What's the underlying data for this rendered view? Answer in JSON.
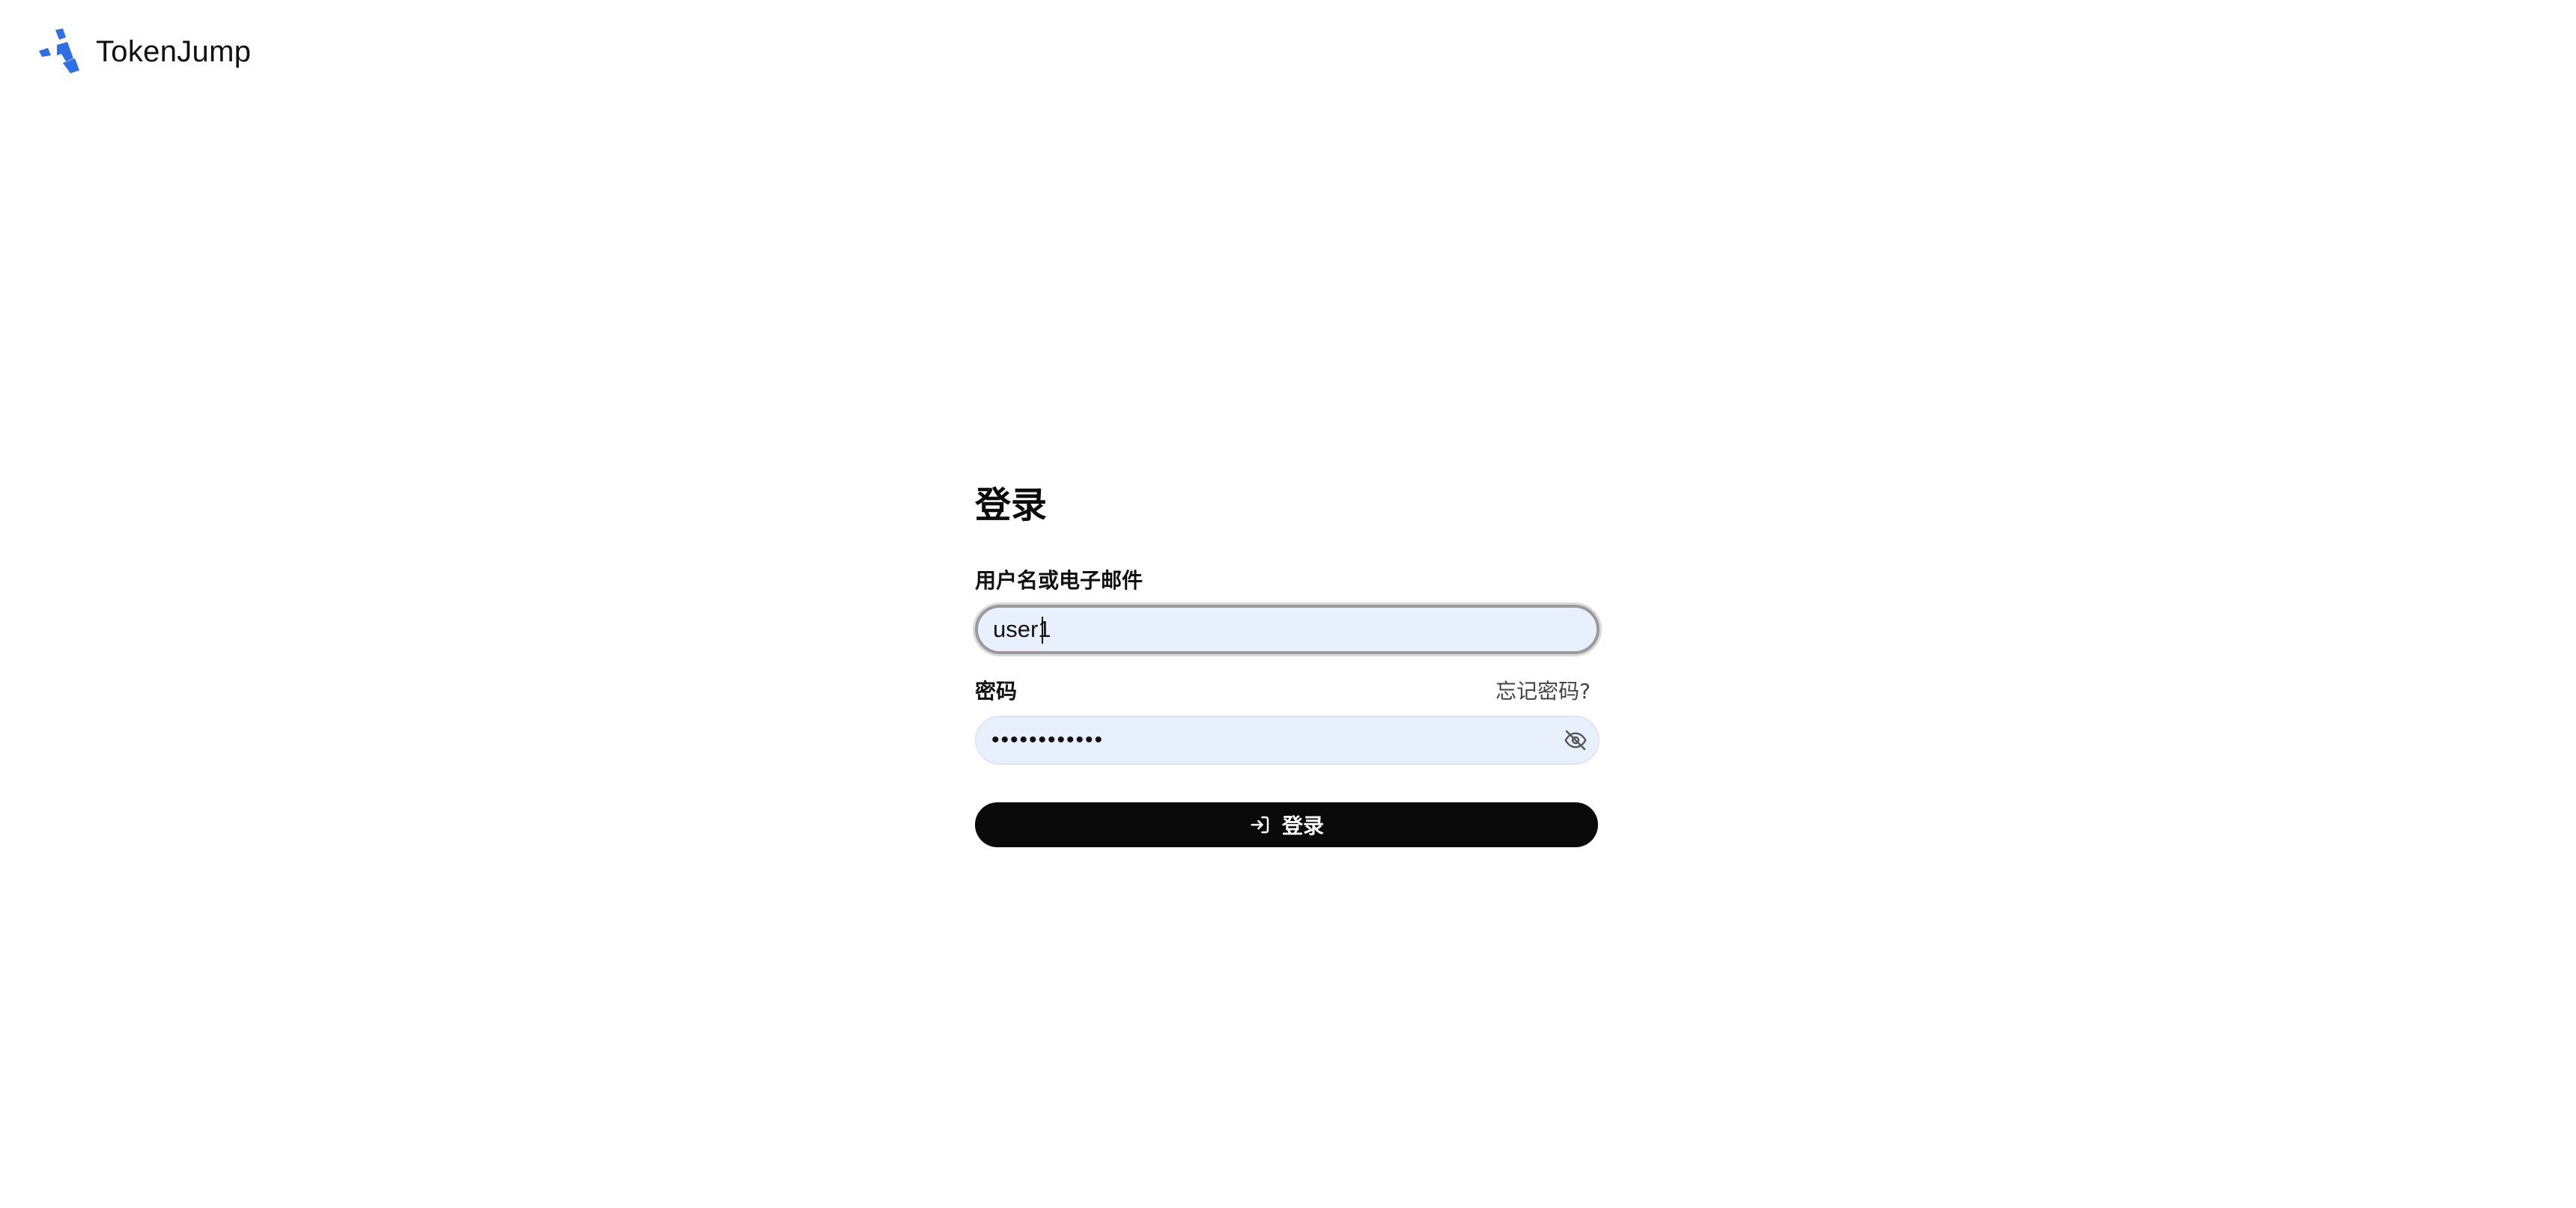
{
  "brand": {
    "name": "TokenJump",
    "logo_icon": "tokenjump-logo-icon",
    "logo_color": "#2f6fe4"
  },
  "login": {
    "title": "登录",
    "username": {
      "label": "用户名或电子邮件",
      "value": "user1"
    },
    "password": {
      "label": "密码",
      "forgot_label": "忘记密码?",
      "masked_value": "••••••••••••",
      "toggle_icon": "eye-off-icon"
    },
    "submit": {
      "label": "登录",
      "icon": "login-arrow-icon",
      "background": "#0a0a0a"
    },
    "input_background": "#e8f0fe"
  }
}
